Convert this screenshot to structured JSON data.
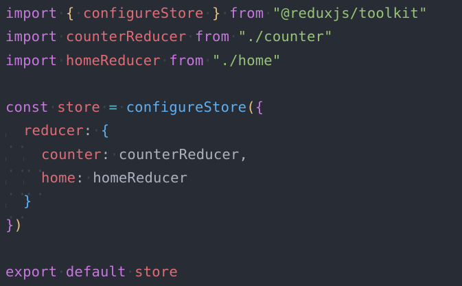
{
  "editor": {
    "lines": [
      {
        "tokens": [
          {
            "t": "import",
            "c": "kw"
          },
          {
            "t": " ",
            "c": "sp"
          },
          {
            "t": "{",
            "c": "brace1"
          },
          {
            "t": " ",
            "c": "sp"
          },
          {
            "t": "configureStore",
            "c": "var"
          },
          {
            "t": " ",
            "c": "sp"
          },
          {
            "t": "}",
            "c": "brace1"
          },
          {
            "t": " ",
            "c": "sp"
          },
          {
            "t": "from",
            "c": "kw"
          },
          {
            "t": " ",
            "c": "sp"
          },
          {
            "t": "\"@reduxjs/toolkit\"",
            "c": "str"
          }
        ]
      },
      {
        "tokens": [
          {
            "t": "import",
            "c": "kw"
          },
          {
            "t": " ",
            "c": "sp"
          },
          {
            "t": "counterReducer",
            "c": "var"
          },
          {
            "t": " ",
            "c": "sp"
          },
          {
            "t": "from",
            "c": "kw"
          },
          {
            "t": " ",
            "c": "sp"
          },
          {
            "t": "\"./counter\"",
            "c": "str"
          }
        ]
      },
      {
        "tokens": [
          {
            "t": "import",
            "c": "kw"
          },
          {
            "t": " ",
            "c": "sp"
          },
          {
            "t": "homeReducer",
            "c": "var"
          },
          {
            "t": " ",
            "c": "sp"
          },
          {
            "t": "from",
            "c": "kw"
          },
          {
            "t": " ",
            "c": "sp"
          },
          {
            "t": "\"./home\"",
            "c": "str"
          }
        ]
      },
      {
        "tokens": []
      },
      {
        "tokens": [
          {
            "t": "const",
            "c": "kw"
          },
          {
            "t": " ",
            "c": "sp"
          },
          {
            "t": "store",
            "c": "var"
          },
          {
            "t": " ",
            "c": "sp"
          },
          {
            "t": "=",
            "c": "op"
          },
          {
            "t": " ",
            "c": "sp"
          },
          {
            "t": "configureStore",
            "c": "fn"
          },
          {
            "t": "(",
            "c": "brace1"
          },
          {
            "t": "{",
            "c": "brace2"
          }
        ]
      },
      {
        "indent": 1,
        "tokens": [
          {
            "t": "reducer",
            "c": "prop"
          },
          {
            "t": ":",
            "c": "punct"
          },
          {
            "t": " ",
            "c": "sp"
          },
          {
            "t": "{",
            "c": "brace3"
          }
        ]
      },
      {
        "indent": 2,
        "tokens": [
          {
            "t": "counter",
            "c": "prop"
          },
          {
            "t": ":",
            "c": "punct"
          },
          {
            "t": " ",
            "c": "sp"
          },
          {
            "t": "counterReducer",
            "c": "plain"
          },
          {
            "t": ",",
            "c": "punct"
          }
        ]
      },
      {
        "indent": 2,
        "tokens": [
          {
            "t": "home",
            "c": "prop"
          },
          {
            "t": ":",
            "c": "punct"
          },
          {
            "t": " ",
            "c": "sp"
          },
          {
            "t": "homeReducer",
            "c": "plain"
          }
        ]
      },
      {
        "indent": 1,
        "tokens": [
          {
            "t": "}",
            "c": "brace3"
          }
        ]
      },
      {
        "tokens": [
          {
            "t": "}",
            "c": "brace2"
          },
          {
            "t": ")",
            "c": "brace1"
          }
        ]
      },
      {
        "tokens": []
      },
      {
        "tokens": [
          {
            "t": "export",
            "c": "kw"
          },
          {
            "t": " ",
            "c": "sp"
          },
          {
            "t": "default",
            "c": "kw"
          },
          {
            "t": " ",
            "c": "sp"
          },
          {
            "t": "store",
            "c": "var"
          }
        ]
      }
    ]
  },
  "colors": {
    "background": "#282c34",
    "keyword": "#c678dd",
    "function": "#61afef",
    "string": "#98c379",
    "variable": "#e06c75",
    "text": "#abb2bf"
  }
}
